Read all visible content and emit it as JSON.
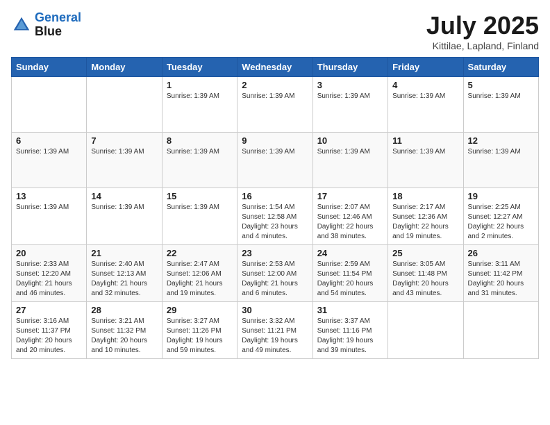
{
  "logo": {
    "line1": "General",
    "line2": "Blue"
  },
  "title": "July 2025",
  "location": "Kittilae, Lapland, Finland",
  "days_of_week": [
    "Sunday",
    "Monday",
    "Tuesday",
    "Wednesday",
    "Thursday",
    "Friday",
    "Saturday"
  ],
  "weeks": [
    [
      {
        "day": null,
        "info": ""
      },
      {
        "day": null,
        "info": ""
      },
      {
        "day": "1",
        "info": "Sunrise: 1:39 AM"
      },
      {
        "day": "2",
        "info": "Sunrise: 1:39 AM"
      },
      {
        "day": "3",
        "info": "Sunrise: 1:39 AM"
      },
      {
        "day": "4",
        "info": "Sunrise: 1:39 AM"
      },
      {
        "day": "5",
        "info": "Sunrise: 1:39 AM"
      }
    ],
    [
      {
        "day": "6",
        "info": "Sunrise: 1:39 AM"
      },
      {
        "day": "7",
        "info": "Sunrise: 1:39 AM"
      },
      {
        "day": "8",
        "info": "Sunrise: 1:39 AM"
      },
      {
        "day": "9",
        "info": "Sunrise: 1:39 AM"
      },
      {
        "day": "10",
        "info": "Sunrise: 1:39 AM"
      },
      {
        "day": "11",
        "info": "Sunrise: 1:39 AM"
      },
      {
        "day": "12",
        "info": "Sunrise: 1:39 AM"
      }
    ],
    [
      {
        "day": "13",
        "info": "Sunrise: 1:39 AM"
      },
      {
        "day": "14",
        "info": "Sunrise: 1:39 AM"
      },
      {
        "day": "15",
        "info": "Sunrise: 1:39 AM"
      },
      {
        "day": "16",
        "info": "Sunrise: 1:54 AM\nSunset: 12:58 AM\nDaylight: 23 hours\nand 4 minutes."
      },
      {
        "day": "17",
        "info": "Sunrise: 2:07 AM\nSunset: 12:46 AM\nDaylight: 22 hours\nand 38 minutes."
      },
      {
        "day": "18",
        "info": "Sunrise: 2:17 AM\nSunset: 12:36 AM\nDaylight: 22 hours\nand 19 minutes."
      },
      {
        "day": "19",
        "info": "Sunrise: 2:25 AM\nSunset: 12:27 AM\nDaylight: 22 hours\nand 2 minutes."
      }
    ],
    [
      {
        "day": "20",
        "info": "Sunrise: 2:33 AM\nSunset: 12:20 AM\nDaylight: 21 hours\nand 46 minutes."
      },
      {
        "day": "21",
        "info": "Sunrise: 2:40 AM\nSunset: 12:13 AM\nDaylight: 21 hours\nand 32 minutes."
      },
      {
        "day": "22",
        "info": "Sunrise: 2:47 AM\nSunset: 12:06 AM\nDaylight: 21 hours\nand 19 minutes."
      },
      {
        "day": "23",
        "info": "Sunrise: 2:53 AM\nSunset: 12:00 AM\nDaylight: 21 hours\nand 6 minutes."
      },
      {
        "day": "24",
        "info": "Sunrise: 2:59 AM\nSunset: 11:54 PM\nDaylight: 20 hours\nand 54 minutes."
      },
      {
        "day": "25",
        "info": "Sunrise: 3:05 AM\nSunset: 11:48 PM\nDaylight: 20 hours\nand 43 minutes."
      },
      {
        "day": "26",
        "info": "Sunrise: 3:11 AM\nSunset: 11:42 PM\nDaylight: 20 hours\nand 31 minutes."
      }
    ],
    [
      {
        "day": "27",
        "info": "Sunrise: 3:16 AM\nSunset: 11:37 PM\nDaylight: 20 hours\nand 20 minutes."
      },
      {
        "day": "28",
        "info": "Sunrise: 3:21 AM\nSunset: 11:32 PM\nDaylight: 20 hours\nand 10 minutes."
      },
      {
        "day": "29",
        "info": "Sunrise: 3:27 AM\nSunset: 11:26 PM\nDaylight: 19 hours\nand 59 minutes."
      },
      {
        "day": "30",
        "info": "Sunrise: 3:32 AM\nSunset: 11:21 PM\nDaylight: 19 hours\nand 49 minutes."
      },
      {
        "day": "31",
        "info": "Sunrise: 3:37 AM\nSunset: 11:16 PM\nDaylight: 19 hours\nand 39 minutes."
      },
      {
        "day": null,
        "info": ""
      },
      {
        "day": null,
        "info": ""
      }
    ]
  ]
}
